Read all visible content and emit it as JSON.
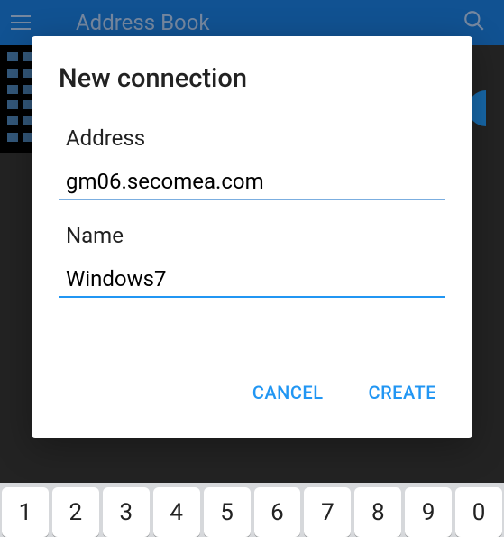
{
  "header": {
    "title": "Address Book"
  },
  "dialog": {
    "title": "New connection",
    "address_label": "Address",
    "address_value": "gm06.secomea.com",
    "name_label": "Name",
    "name_value": "Windows7",
    "cancel": "CANCEL",
    "create": "CREATE"
  },
  "keyboard": {
    "keys": [
      "1",
      "2",
      "3",
      "4",
      "5",
      "6",
      "7",
      "8",
      "9",
      "0"
    ]
  }
}
